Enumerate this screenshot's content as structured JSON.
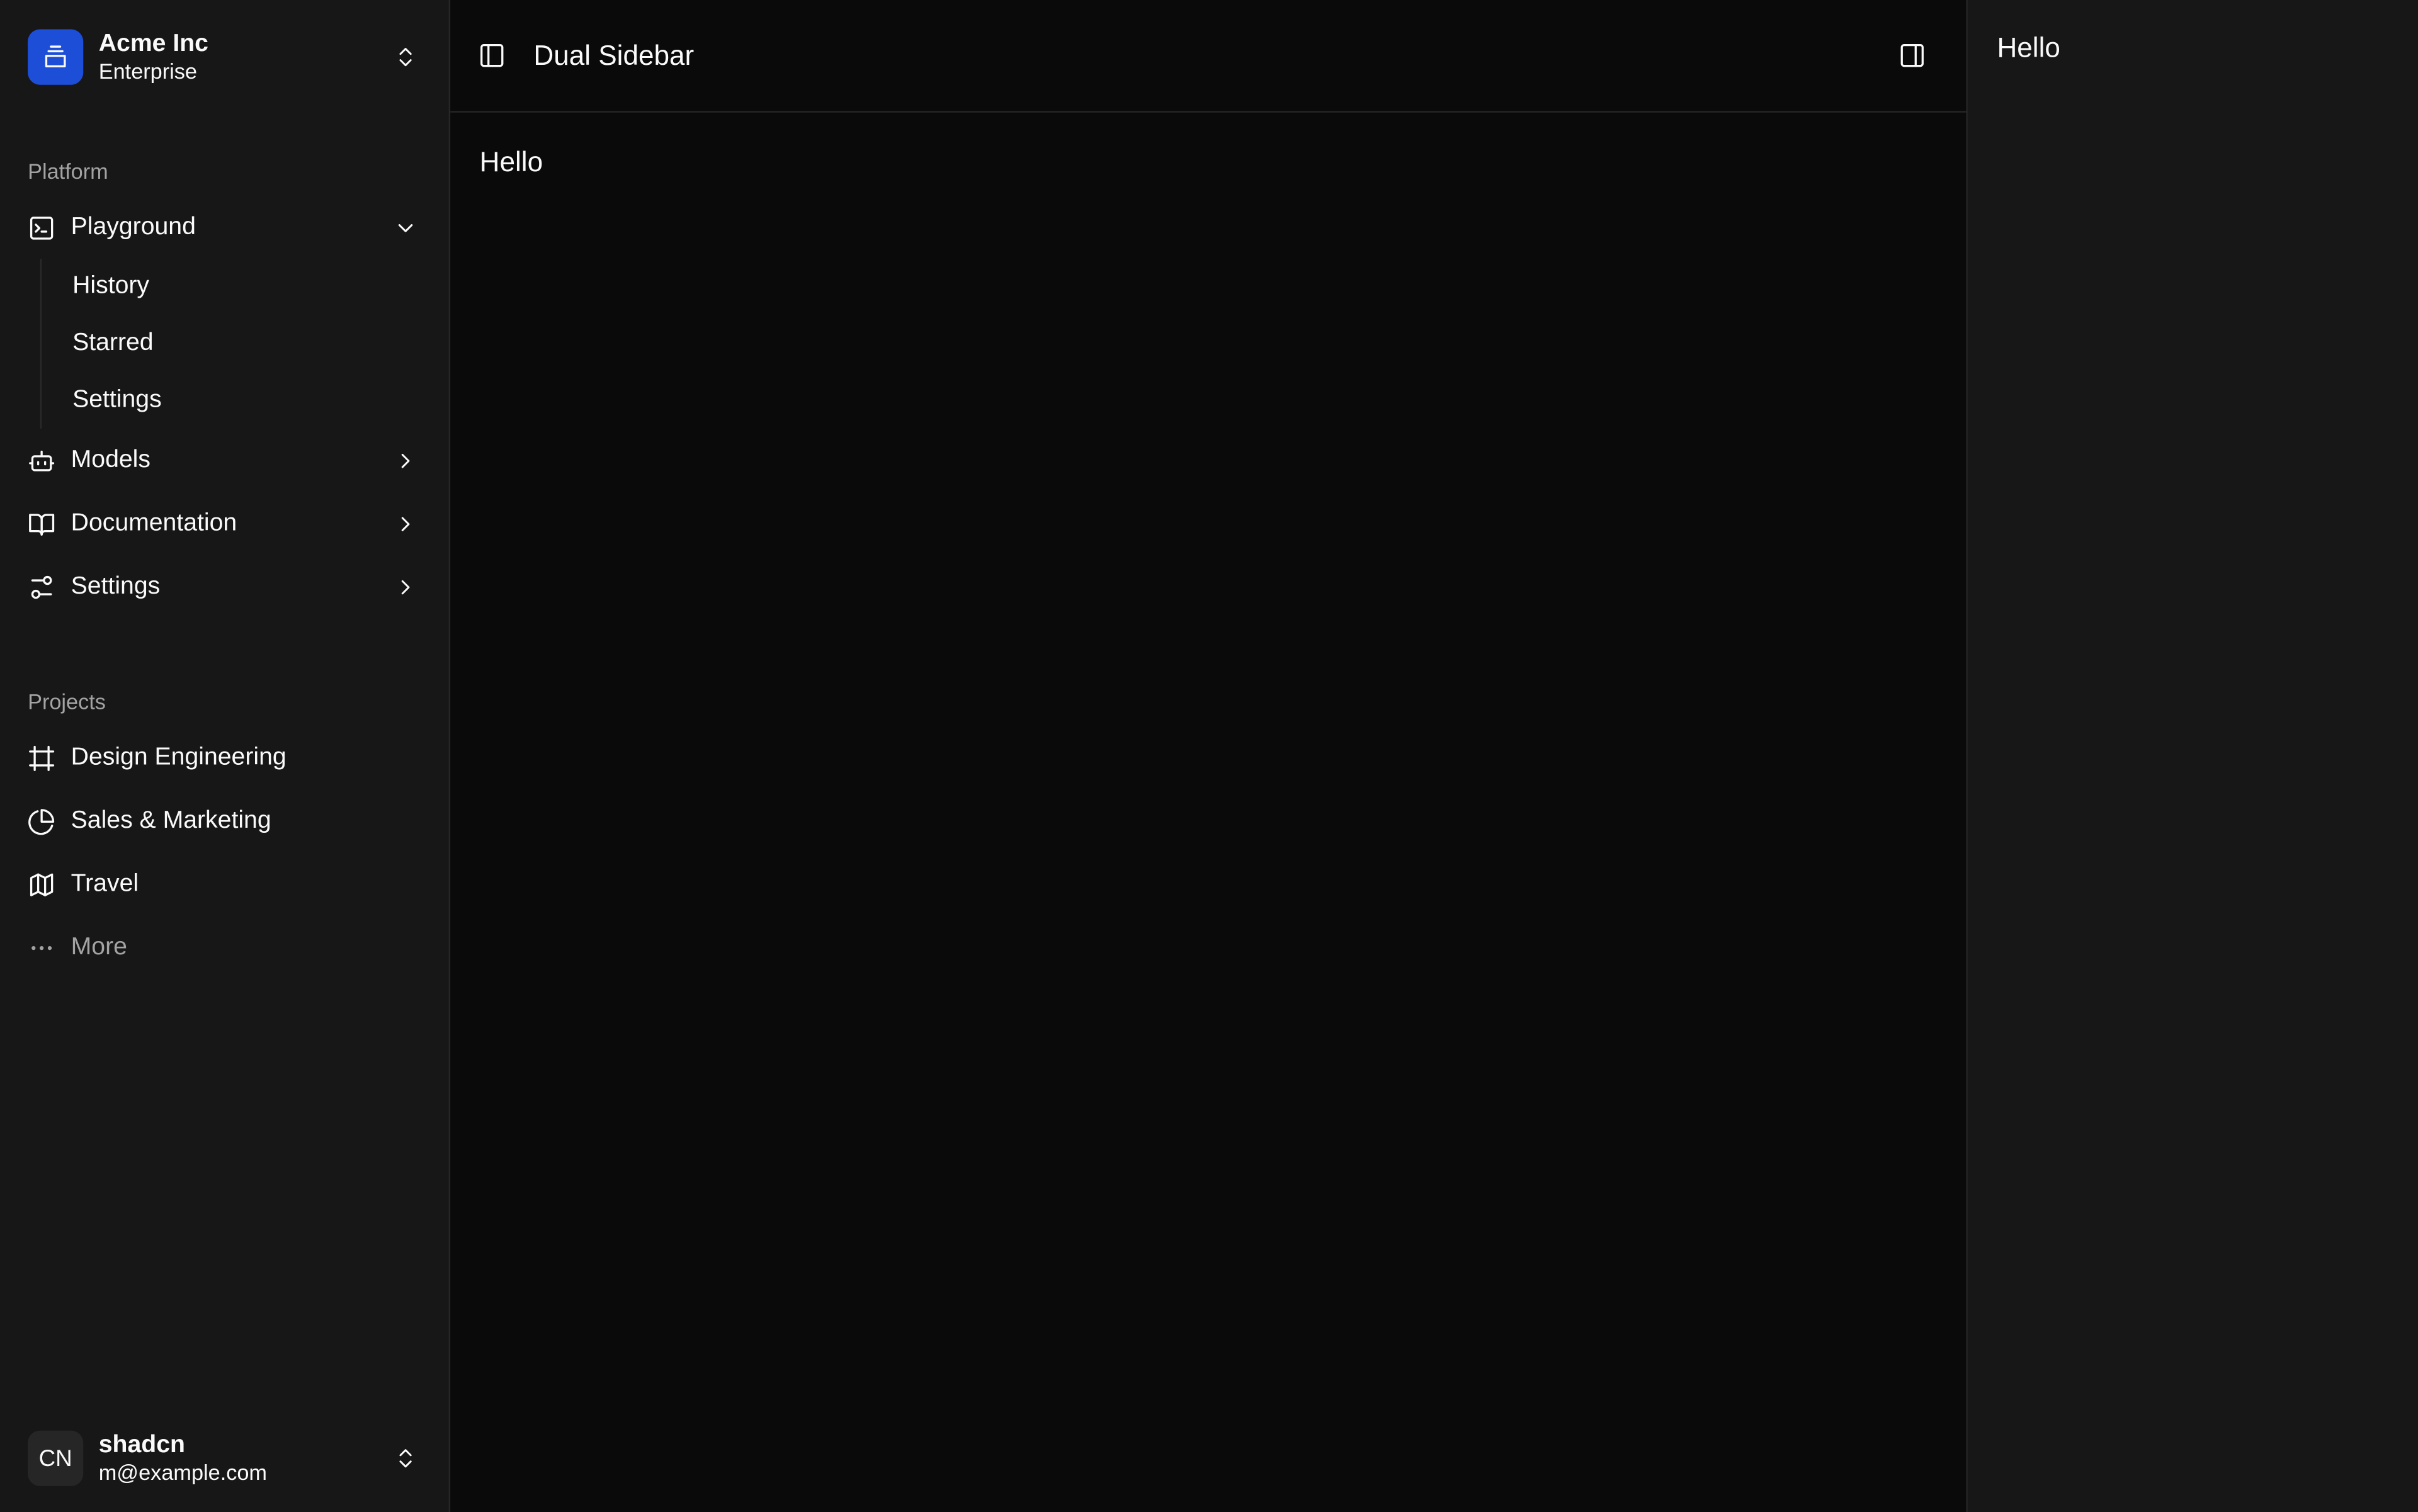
{
  "team": {
    "name": "Acme Inc",
    "plan": "Enterprise"
  },
  "platform": {
    "label": "Platform",
    "items": [
      {
        "label": "Playground",
        "icon": "terminal-square-icon",
        "expanded": true,
        "subitems": [
          "History",
          "Starred",
          "Settings"
        ]
      },
      {
        "label": "Models",
        "icon": "bot-icon"
      },
      {
        "label": "Documentation",
        "icon": "book-open-icon"
      },
      {
        "label": "Settings",
        "icon": "settings-sliders-icon"
      }
    ]
  },
  "projects": {
    "label": "Projects",
    "items": [
      {
        "label": "Design Engineering",
        "icon": "frame-icon"
      },
      {
        "label": "Sales & Marketing",
        "icon": "pie-chart-icon"
      },
      {
        "label": "Travel",
        "icon": "map-icon"
      },
      {
        "label": "More",
        "icon": "more-horizontal-icon"
      }
    ]
  },
  "user": {
    "initials": "CN",
    "name": "shadcn",
    "email": "m@example.com"
  },
  "header": {
    "title": "Dual Sidebar"
  },
  "main": {
    "content": "Hello"
  },
  "right_sidebar": {
    "content": "Hello"
  },
  "colors": {
    "accent": "#1d4ed8",
    "sidebar_bg": "#171717",
    "main_bg": "#0a0a0a"
  }
}
